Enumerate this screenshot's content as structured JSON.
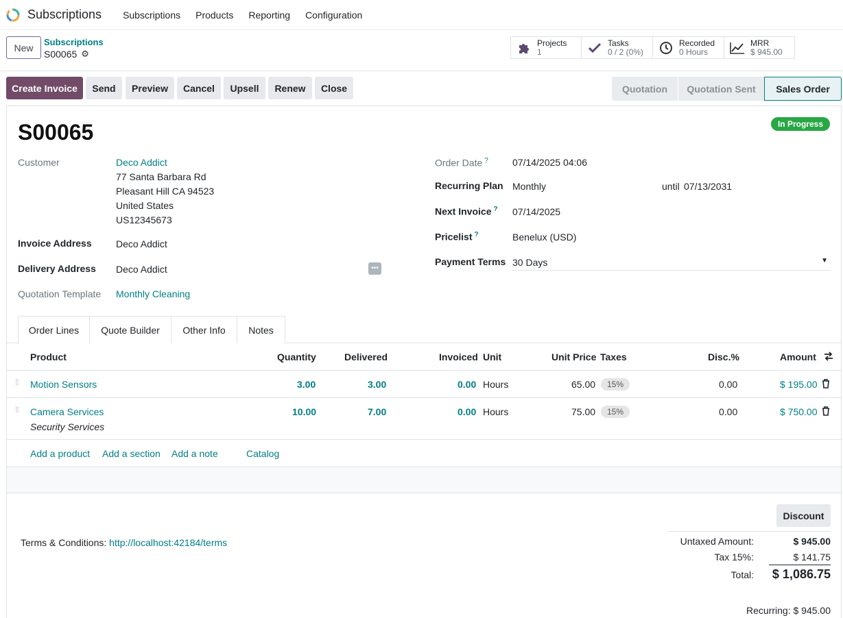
{
  "app": {
    "name": "Subscriptions",
    "menu": [
      "Subscriptions",
      "Products",
      "Reporting",
      "Configuration"
    ]
  },
  "control": {
    "new_label": "New",
    "breadcrumb_parent": "Subscriptions",
    "breadcrumb_current": "S00065"
  },
  "smart_buttons": [
    {
      "label": "Projects",
      "value": "1",
      "icon": "puzzle-icon"
    },
    {
      "label": "Tasks",
      "value": "0 / 2 (0%)",
      "icon": "check-icon"
    },
    {
      "label": "Recorded",
      "value": "0 Hours",
      "icon": "clock-icon"
    },
    {
      "label": "MRR",
      "value": "$ 945.00",
      "icon": "chart-line-icon"
    }
  ],
  "actions": {
    "create_invoice": "Create Invoice",
    "send": "Send",
    "preview": "Preview",
    "cancel": "Cancel",
    "upsell": "Upsell",
    "renew": "Renew",
    "close": "Close"
  },
  "stages": [
    "Quotation",
    "Quotation Sent",
    "Sales Order"
  ],
  "record": {
    "name": "S00065",
    "status": "In Progress",
    "status_color": "#28a745",
    "customer_label": "Customer",
    "customer_name": "Deco Addict",
    "address": [
      "77 Santa Barbara Rd",
      "Pleasant Hill CA 94523",
      "United States",
      "US12345673"
    ],
    "invoice_address_label": "Invoice Address",
    "invoice_address": "Deco Addict",
    "delivery_address_label": "Delivery Address",
    "delivery_address": "Deco Addict",
    "quotation_template_label": "Quotation Template",
    "quotation_template": "Monthly Cleaning",
    "order_date_label": "Order Date",
    "order_date": "07/14/2025 04:06",
    "recurring_plan_label": "Recurring Plan",
    "recurring_plan": "Monthly",
    "until_label": "until",
    "until_date": "07/13/2031",
    "next_invoice_label": "Next Invoice",
    "next_invoice": "07/14/2025",
    "pricelist_label": "Pricelist",
    "pricelist": "Benelux (USD)",
    "payment_terms_label": "Payment Terms",
    "payment_terms": "30 Days",
    "help_mark": "?"
  },
  "tabs": [
    "Order Lines",
    "Quote Builder",
    "Other Info",
    "Notes"
  ],
  "table": {
    "headers": {
      "product": "Product",
      "quantity": "Quantity",
      "delivered": "Delivered",
      "invoiced": "Invoiced",
      "unit": "Unit",
      "unit_price": "Unit Price",
      "taxes": "Taxes",
      "disc": "Disc.%",
      "amount": "Amount"
    },
    "rows": [
      {
        "product": "Motion Sensors",
        "description": "",
        "quantity": "3.00",
        "delivered": "3.00",
        "invoiced": "0.00",
        "unit": "Hours",
        "unit_price": "65.00",
        "tax": "15%",
        "disc": "0.00",
        "amount": "$ 195.00"
      },
      {
        "product": "Camera Services",
        "description": "Security Services",
        "quantity": "10.00",
        "delivered": "7.00",
        "invoiced": "0.00",
        "unit": "Hours",
        "unit_price": "75.00",
        "tax": "15%",
        "disc": "0.00",
        "amount": "$ 750.00"
      }
    ],
    "add_links": [
      "Add a product",
      "Add a section",
      "Add a note",
      "Catalog"
    ]
  },
  "footer": {
    "discount_label": "Discount",
    "terms_label": "Terms & Conditions:",
    "terms_url": "http://localhost:42184/terms",
    "untaxed_label": "Untaxed Amount:",
    "untaxed_value": "$ 945.00",
    "tax_label": "Tax 15%:",
    "tax_value": "$ 141.75",
    "total_label": "Total:",
    "total_value": "$ 1,086.75",
    "recurring_label": "Recurring:",
    "recurring_value": "$ 945.00"
  },
  "colors": {
    "primary": "#714b67",
    "link": "#017e84"
  }
}
